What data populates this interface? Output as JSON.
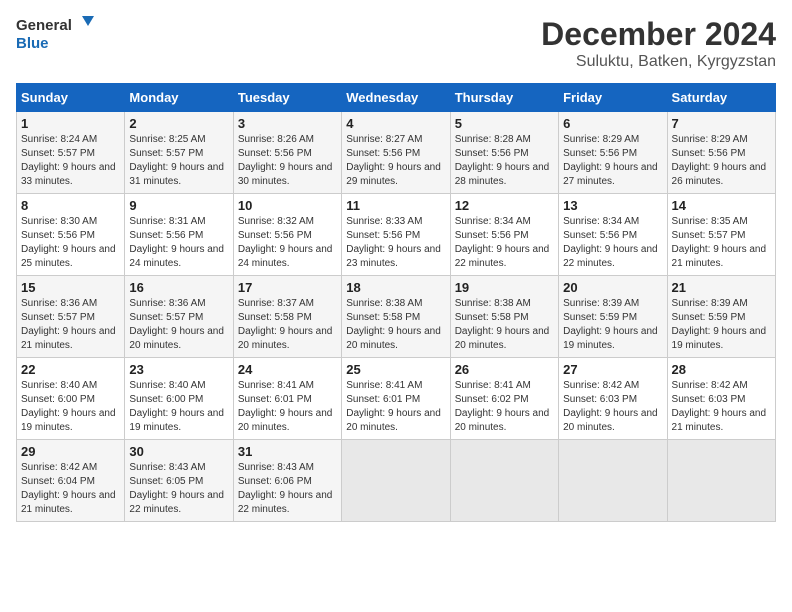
{
  "logo": {
    "line1": "General",
    "line2": "Blue"
  },
  "title": "December 2024",
  "location": "Suluktu, Batken, Kyrgyzstan",
  "weekdays": [
    "Sunday",
    "Monday",
    "Tuesday",
    "Wednesday",
    "Thursday",
    "Friday",
    "Saturday"
  ],
  "weeks": [
    [
      {
        "day": "1",
        "sunrise": "Sunrise: 8:24 AM",
        "sunset": "Sunset: 5:57 PM",
        "daylight": "Daylight: 9 hours and 33 minutes."
      },
      {
        "day": "2",
        "sunrise": "Sunrise: 8:25 AM",
        "sunset": "Sunset: 5:57 PM",
        "daylight": "Daylight: 9 hours and 31 minutes."
      },
      {
        "day": "3",
        "sunrise": "Sunrise: 8:26 AM",
        "sunset": "Sunset: 5:56 PM",
        "daylight": "Daylight: 9 hours and 30 minutes."
      },
      {
        "day": "4",
        "sunrise": "Sunrise: 8:27 AM",
        "sunset": "Sunset: 5:56 PM",
        "daylight": "Daylight: 9 hours and 29 minutes."
      },
      {
        "day": "5",
        "sunrise": "Sunrise: 8:28 AM",
        "sunset": "Sunset: 5:56 PM",
        "daylight": "Daylight: 9 hours and 28 minutes."
      },
      {
        "day": "6",
        "sunrise": "Sunrise: 8:29 AM",
        "sunset": "Sunset: 5:56 PM",
        "daylight": "Daylight: 9 hours and 27 minutes."
      },
      {
        "day": "7",
        "sunrise": "Sunrise: 8:29 AM",
        "sunset": "Sunset: 5:56 PM",
        "daylight": "Daylight: 9 hours and 26 minutes."
      }
    ],
    [
      {
        "day": "8",
        "sunrise": "Sunrise: 8:30 AM",
        "sunset": "Sunset: 5:56 PM",
        "daylight": "Daylight: 9 hours and 25 minutes."
      },
      {
        "day": "9",
        "sunrise": "Sunrise: 8:31 AM",
        "sunset": "Sunset: 5:56 PM",
        "daylight": "Daylight: 9 hours and 24 minutes."
      },
      {
        "day": "10",
        "sunrise": "Sunrise: 8:32 AM",
        "sunset": "Sunset: 5:56 PM",
        "daylight": "Daylight: 9 hours and 24 minutes."
      },
      {
        "day": "11",
        "sunrise": "Sunrise: 8:33 AM",
        "sunset": "Sunset: 5:56 PM",
        "daylight": "Daylight: 9 hours and 23 minutes."
      },
      {
        "day": "12",
        "sunrise": "Sunrise: 8:34 AM",
        "sunset": "Sunset: 5:56 PM",
        "daylight": "Daylight: 9 hours and 22 minutes."
      },
      {
        "day": "13",
        "sunrise": "Sunrise: 8:34 AM",
        "sunset": "Sunset: 5:56 PM",
        "daylight": "Daylight: 9 hours and 22 minutes."
      },
      {
        "day": "14",
        "sunrise": "Sunrise: 8:35 AM",
        "sunset": "Sunset: 5:57 PM",
        "daylight": "Daylight: 9 hours and 21 minutes."
      }
    ],
    [
      {
        "day": "15",
        "sunrise": "Sunrise: 8:36 AM",
        "sunset": "Sunset: 5:57 PM",
        "daylight": "Daylight: 9 hours and 21 minutes."
      },
      {
        "day": "16",
        "sunrise": "Sunrise: 8:36 AM",
        "sunset": "Sunset: 5:57 PM",
        "daylight": "Daylight: 9 hours and 20 minutes."
      },
      {
        "day": "17",
        "sunrise": "Sunrise: 8:37 AM",
        "sunset": "Sunset: 5:58 PM",
        "daylight": "Daylight: 9 hours and 20 minutes."
      },
      {
        "day": "18",
        "sunrise": "Sunrise: 8:38 AM",
        "sunset": "Sunset: 5:58 PM",
        "daylight": "Daylight: 9 hours and 20 minutes."
      },
      {
        "day": "19",
        "sunrise": "Sunrise: 8:38 AM",
        "sunset": "Sunset: 5:58 PM",
        "daylight": "Daylight: 9 hours and 20 minutes."
      },
      {
        "day": "20",
        "sunrise": "Sunrise: 8:39 AM",
        "sunset": "Sunset: 5:59 PM",
        "daylight": "Daylight: 9 hours and 19 minutes."
      },
      {
        "day": "21",
        "sunrise": "Sunrise: 8:39 AM",
        "sunset": "Sunset: 5:59 PM",
        "daylight": "Daylight: 9 hours and 19 minutes."
      }
    ],
    [
      {
        "day": "22",
        "sunrise": "Sunrise: 8:40 AM",
        "sunset": "Sunset: 6:00 PM",
        "daylight": "Daylight: 9 hours and 19 minutes."
      },
      {
        "day": "23",
        "sunrise": "Sunrise: 8:40 AM",
        "sunset": "Sunset: 6:00 PM",
        "daylight": "Daylight: 9 hours and 19 minutes."
      },
      {
        "day": "24",
        "sunrise": "Sunrise: 8:41 AM",
        "sunset": "Sunset: 6:01 PM",
        "daylight": "Daylight: 9 hours and 20 minutes."
      },
      {
        "day": "25",
        "sunrise": "Sunrise: 8:41 AM",
        "sunset": "Sunset: 6:01 PM",
        "daylight": "Daylight: 9 hours and 20 minutes."
      },
      {
        "day": "26",
        "sunrise": "Sunrise: 8:41 AM",
        "sunset": "Sunset: 6:02 PM",
        "daylight": "Daylight: 9 hours and 20 minutes."
      },
      {
        "day": "27",
        "sunrise": "Sunrise: 8:42 AM",
        "sunset": "Sunset: 6:03 PM",
        "daylight": "Daylight: 9 hours and 20 minutes."
      },
      {
        "day": "28",
        "sunrise": "Sunrise: 8:42 AM",
        "sunset": "Sunset: 6:03 PM",
        "daylight": "Daylight: 9 hours and 21 minutes."
      }
    ],
    [
      {
        "day": "29",
        "sunrise": "Sunrise: 8:42 AM",
        "sunset": "Sunset: 6:04 PM",
        "daylight": "Daylight: 9 hours and 21 minutes."
      },
      {
        "day": "30",
        "sunrise": "Sunrise: 8:43 AM",
        "sunset": "Sunset: 6:05 PM",
        "daylight": "Daylight: 9 hours and 22 minutes."
      },
      {
        "day": "31",
        "sunrise": "Sunrise: 8:43 AM",
        "sunset": "Sunset: 6:06 PM",
        "daylight": "Daylight: 9 hours and 22 minutes."
      },
      null,
      null,
      null,
      null
    ]
  ]
}
